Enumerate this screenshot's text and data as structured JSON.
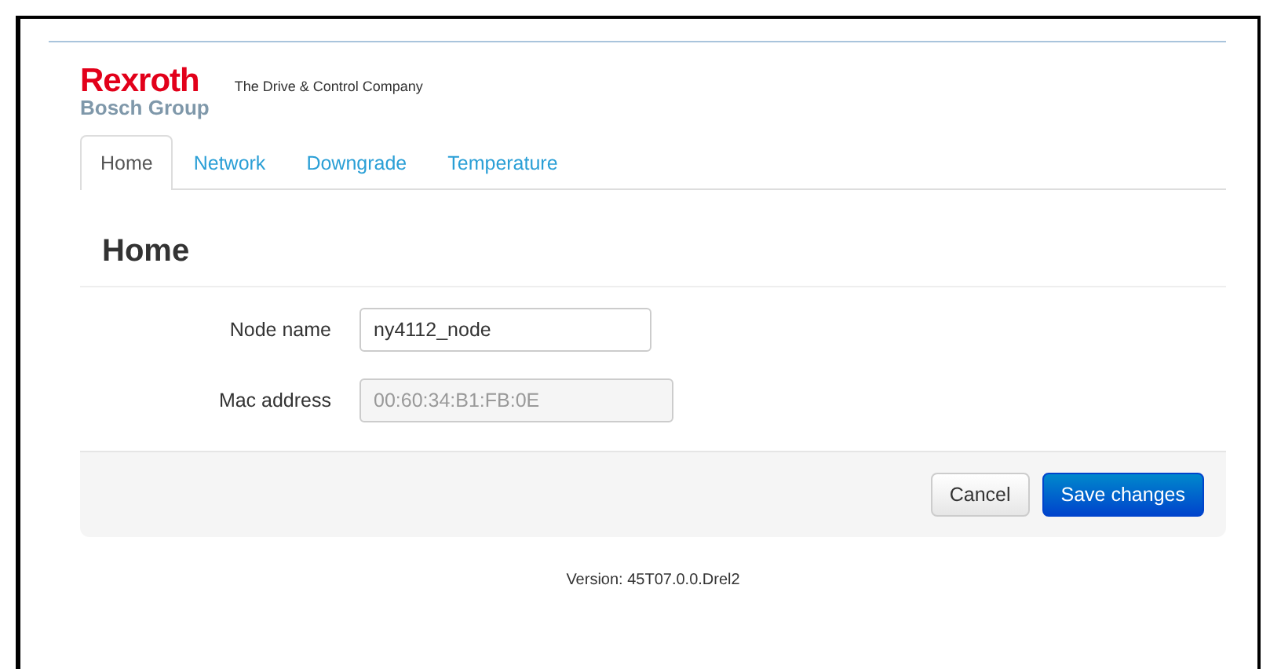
{
  "logo": {
    "brand": "Rexroth",
    "group": "Bosch Group",
    "tagline": "The Drive & Control Company"
  },
  "tabs": [
    {
      "label": "Home",
      "selected": true
    },
    {
      "label": "Network",
      "selected": false
    },
    {
      "label": "Downgrade",
      "selected": false
    },
    {
      "label": "Temperature",
      "selected": false
    }
  ],
  "heading": "Home",
  "fields": [
    {
      "label": "Node name",
      "value": "ny4112_node",
      "disabled": false
    },
    {
      "label": "Mac address",
      "value": "00:60:34:B1:FB:0E",
      "disabled": true
    }
  ],
  "buttons": [
    {
      "label": "Cancel",
      "kind": "default"
    },
    {
      "label": "Save changes",
      "kind": "primary"
    }
  ],
  "version": "Version: 45T07.0.0.Drel2"
}
